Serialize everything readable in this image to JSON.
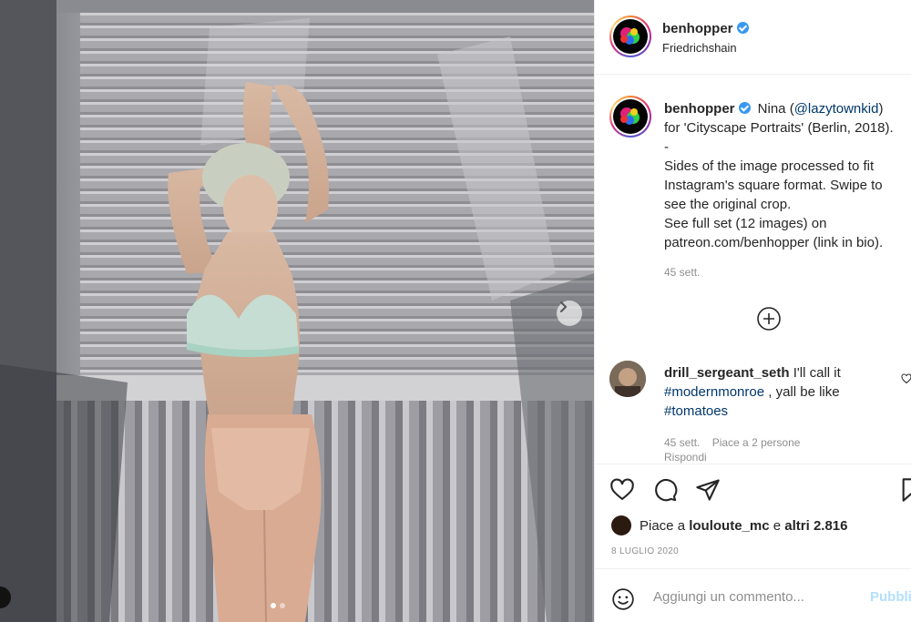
{
  "post": {
    "author": "benhopper",
    "location": "Friedrichshain",
    "verified": true
  },
  "caption": {
    "author": "benhopper",
    "lines": [
      "for 'Cityscape Portraits' (Berlin, 2018).",
      "-",
      "Sides of the image processed to fit",
      "Instagram's square format. Swipe to",
      "see the original crop.",
      "See full set (12 images) on",
      "patreon.com/benhopper (link in bio)."
    ],
    "prefix": "Nina (",
    "mention": "@lazytownkid",
    "suffix": ")",
    "time": "45 sett."
  },
  "comment": {
    "author": "drill_sergeant_seth",
    "text_lead": "I'll call it",
    "tag1": "#modernmonroe",
    "text_mid": ", yall be like",
    "tag2": "#tomatoes",
    "time": "45 sett.",
    "likes": "Piace a 2 persone",
    "reply": "Rispondi"
  },
  "actions": {
    "likes_prefix": "Piace a ",
    "likes_user": "louloute_mc",
    "likes_mid": " e ",
    "likes_others": "altri 2.816",
    "date": "8 LUGLIO 2020"
  },
  "add_comment": {
    "placeholder": "Aggiungi un commento...",
    "post_label": "Pubblica"
  },
  "carousel": {
    "current_index": 1,
    "total": 2
  },
  "icons": {
    "verified": "verified-badge-icon",
    "next": "chevron-right-icon",
    "load_more": "plus-circle-icon",
    "like": "heart-icon",
    "comment": "comment-bubble-icon",
    "share": "paper-plane-icon",
    "save": "bookmark-icon",
    "emoji": "smiley-icon"
  },
  "colors": {
    "verified_blue": "#3897f0",
    "link": "#00376b",
    "muted": "#8e8e8e",
    "post_disabled": "#b2dffc"
  }
}
